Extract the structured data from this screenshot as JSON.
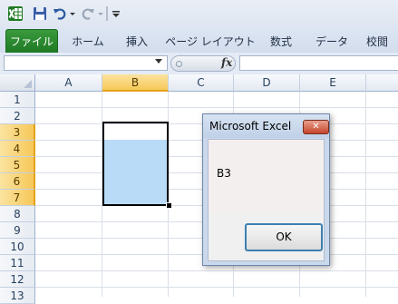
{
  "qat": {
    "icons": [
      "excel-logo-icon",
      "save-icon",
      "undo-icon",
      "dropdown-arrow-icon",
      "redo-icon",
      "dropdown-arrow-icon",
      "customize-toolbar-icon"
    ]
  },
  "ribbon": {
    "tabs": [
      "ファイル",
      "ホーム",
      "挿入",
      "ページ レイアウト",
      "数式",
      "データ",
      "校閲"
    ]
  },
  "formula_bar": {
    "name_box_value": "",
    "fx_label": "fx",
    "formula_value": ""
  },
  "sheet": {
    "columns": [
      "A",
      "B",
      "C",
      "D",
      "E"
    ],
    "rows": [
      "1",
      "2",
      "3",
      "4",
      "5",
      "6",
      "7",
      "8",
      "9",
      "10",
      "11",
      "12",
      "13"
    ],
    "selected_column": "B",
    "selected_rows": [
      "3",
      "4",
      "5",
      "6",
      "7"
    ],
    "selection_fill_color": "#b9dbf7"
  },
  "dialog": {
    "title": "Microsoft Excel",
    "close_symbol": "✕",
    "message": "B3",
    "ok_label": "OK"
  },
  "colors": {
    "file_tab": "#2a8a2f",
    "selected_header": "#f6c859",
    "close_button": "#c5432a"
  }
}
